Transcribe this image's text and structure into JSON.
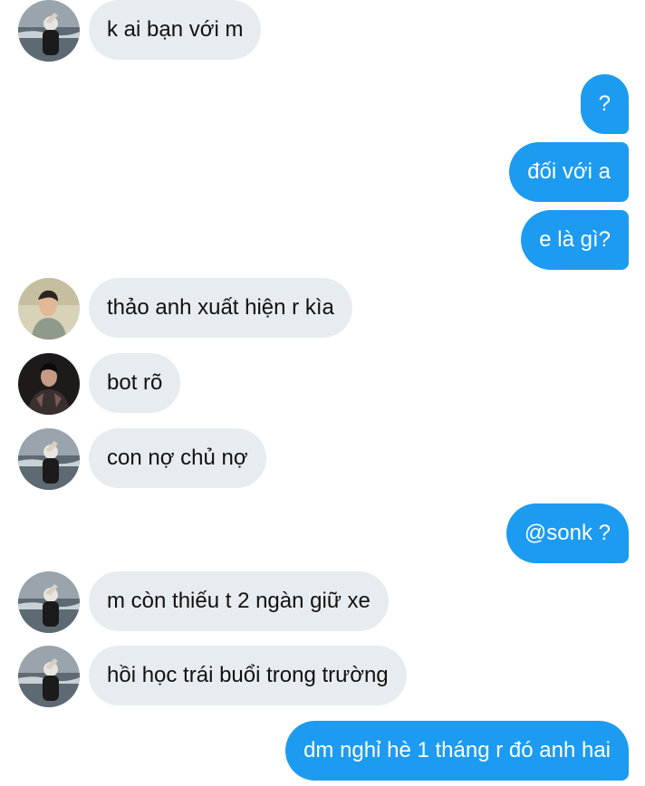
{
  "messages": [
    {
      "side": "in",
      "avatar": "sea",
      "text": "k ai bạn với m"
    },
    {
      "side": "out",
      "text": "?"
    },
    {
      "side": "out",
      "text": "đối với a"
    },
    {
      "side": "out",
      "text": "e là gì?"
    },
    {
      "side": "in",
      "avatar": "man-light",
      "text": "thảo anh xuất hiện r kìa"
    },
    {
      "side": "in",
      "avatar": "man-dark",
      "text": "bot rõ"
    },
    {
      "side": "in",
      "avatar": "sea",
      "text": "con nợ chủ nợ"
    },
    {
      "side": "out",
      "text": "@sonk ?"
    },
    {
      "side": "in",
      "avatar": "sea",
      "text": "m còn thiếu t 2 ngàn giữ xe"
    },
    {
      "side": "in",
      "avatar": "sea",
      "text": "hồi học trái buổi trong trường"
    },
    {
      "side": "out",
      "text": "dm nghỉ hè 1 tháng r đó anh hai"
    }
  ],
  "colors": {
    "incoming_bubble": "#e7ecf0",
    "outgoing_bubble": "#1d9bf0",
    "incoming_text": "#111111",
    "outgoing_text": "#ffffff"
  }
}
